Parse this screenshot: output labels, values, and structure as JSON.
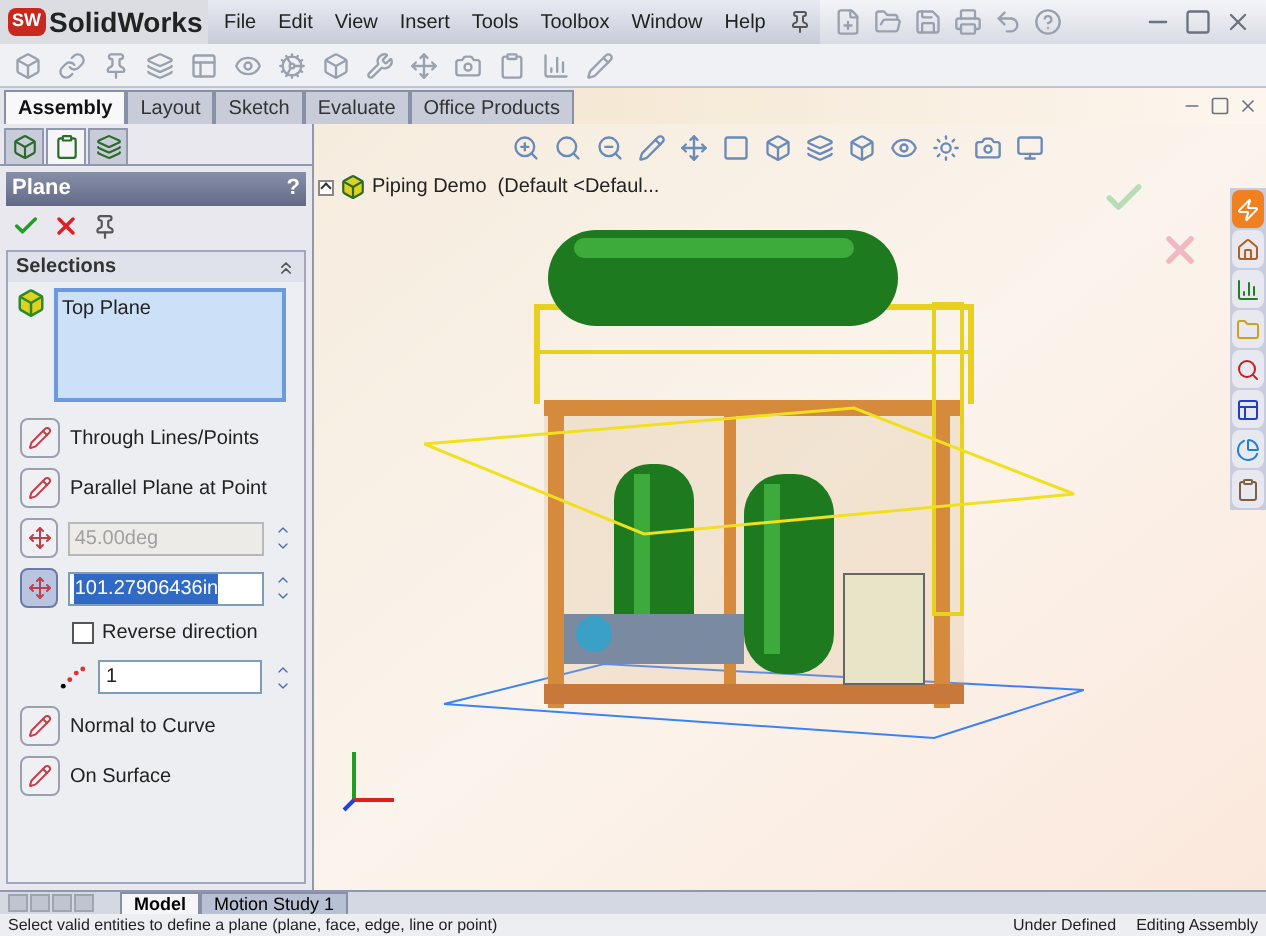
{
  "app": {
    "logo_mark": "SW",
    "logo_text": "SolidWorks"
  },
  "menu": [
    "File",
    "Edit",
    "View",
    "Insert",
    "Tools",
    "Toolbox",
    "Window",
    "Help"
  ],
  "command_tabs": [
    {
      "label": "Assembly",
      "selected": true
    },
    {
      "label": "Layout",
      "selected": false
    },
    {
      "label": "Sketch",
      "selected": false
    },
    {
      "label": "Evaluate",
      "selected": false
    },
    {
      "label": "Office Products",
      "selected": false
    }
  ],
  "manager_tabs": [
    {
      "selected": false
    },
    {
      "selected": true
    },
    {
      "selected": false
    }
  ],
  "property_manager": {
    "title": "Plane",
    "help": "?",
    "selections_title": "Selections",
    "selection_items": [
      "Top Plane"
    ],
    "options": [
      {
        "kind": "toggle",
        "label": "Through Lines/Points",
        "selected": false
      },
      {
        "kind": "toggle",
        "label": "Parallel Plane at Point",
        "selected": false
      },
      {
        "kind": "spin",
        "value": "45.00deg",
        "disabled": true,
        "selected": false
      },
      {
        "kind": "spin",
        "value": "101.27906436in",
        "disabled": false,
        "selected": true
      },
      {
        "kind": "check",
        "label": "Reverse direction",
        "checked": false
      },
      {
        "kind": "count",
        "value": "1"
      },
      {
        "kind": "toggle",
        "label": "Normal to Curve",
        "selected": false
      },
      {
        "kind": "toggle",
        "label": "On Surface",
        "selected": false
      }
    ]
  },
  "tree": {
    "label": "Piping Demo  (Default <Defaul...",
    "expanded": false
  },
  "bottom_tabs": [
    {
      "label": "Model",
      "selected": true
    },
    {
      "label": "Motion Study 1",
      "selected": false
    }
  ],
  "status_bar": [
    "Select valid entities to define a plane (plane, face, edge, line or point)",
    "Under Defined",
    "Editing Assembly"
  ]
}
